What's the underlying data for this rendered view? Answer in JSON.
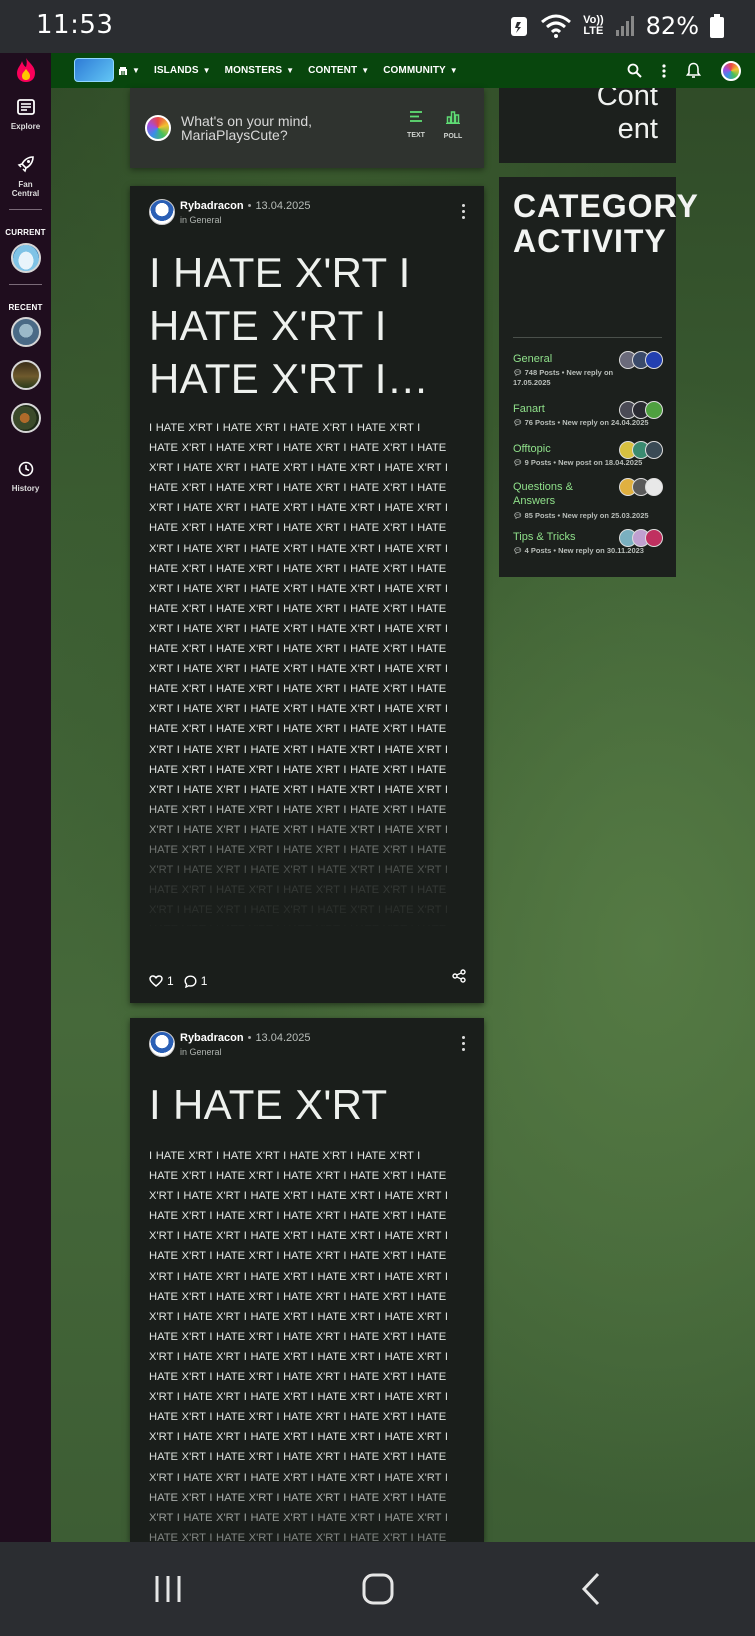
{
  "status_bar": {
    "time": "11:53",
    "battery_pct": "82%",
    "network": "LTE"
  },
  "left_rail": {
    "explore_label": "Explore",
    "fan_central_label": "Fan Central",
    "current_label": "CURRENT",
    "recent_label": "RECENT",
    "history_label": "History"
  },
  "top_nav": {
    "links": [
      "ISLANDS",
      "MONSTERS",
      "CONTENT",
      "COMMUNITY"
    ]
  },
  "composer": {
    "prompt_line1": "What's on your mind,",
    "prompt_line2": "MariaPlaysCute?",
    "text_label": "TEXT",
    "poll_label": "POLL"
  },
  "posts": [
    {
      "author": "Rybadracon",
      "date": "13.04.2025",
      "category": "in General",
      "title_line1": "I HATE X'RT I",
      "title_line2": "HATE X'RT I",
      "title_line3": "HATE X'RT I…",
      "body": "I HATE X'RT I HATE X'RT I HATE X'RT I HATE X'RT I HATE X'RT I HATE X'RT I HATE X'RT I HATE X'RT I HATE X'RT I HATE X'RT I HATE X'RT I HATE X'RT I HATE X'RT I HATE X'RT I HATE X'RT I HATE X'RT I HATE X'RT I HATE X'RT I HATE X'RT I HATE X'RT I HATE X'RT I HATE X'RT I HATE X'RT I HATE X'RT I HATE X'RT I HATE X'RT I HATE X'RT I HATE X'RT I HATE X'RT I HATE X'RT I HATE X'RT I HATE X'RT I HATE X'RT I HATE X'RT I HATE X'RT I HATE X'RT I HATE X'RT I HATE X'RT I HATE X'RT I HATE X'RT I HATE X'RT I HATE X'RT I HATE X'RT I HATE X'RT I HATE X'RT I HATE X'RT I HATE X'RT I HATE X'RT I HATE X'RT I HATE X'RT I HATE X'RT I HATE X'RT I HATE X'RT I HATE X'RT I HATE X'RT I HATE X'RT I HATE X'RT I HATE X'RT I HATE X'RT I HATE X'RT I HATE X'RT I HATE X'RT I HATE X'RT I HATE X'RT I HATE X'RT I HATE X'RT I HATE X'RT I HATE X'RT I HATE X'RT I HATE X'RT I HATE X'RT I HATE X'RT I HATE X'RT I HATE X'RT I HATE X'RT I HATE X'RT I HATE X'RT I HATE X'RT I HATE X'RT I HATE X'RT I HATE X'RT I HATE X'RT I HATE X'RT I HATE X'RT I HATE X'RT I HATE X'RT I HATE X'RT I HATE X'RT I HATE X'RT I HATE X'RT I HATE X'RT I HATE X'RT I HATE X'RT I HATE X'RT I HATE X'RT I HATE X'RT I HATE X'RT I HATE X'RT I HATE X'RT I HATE X'RT I HATE X'RT I HATE X'RT I HATE X'RT I HATE X'RT I HATE X'RT I HATE X'RT I HATE X'RT I HATE X'RT I HATE X'RT I HATE X'RT I HATE X'RT I HATE X'RT I HATE X'RT I HATE X'RT I HATE X'RT I HATE X'RT I HATE X'RT I",
      "likes": "1",
      "comments": "1"
    },
    {
      "author": "Rybadracon",
      "date": "13.04.2025",
      "category": "in General",
      "title_line1": "I HATE X'RT",
      "body": "I HATE X'RT I HATE X'RT I HATE X'RT I HATE X'RT I HATE X'RT I HATE X'RT I HATE X'RT I HATE X'RT I HATE X'RT I HATE X'RT I HATE X'RT I HATE X'RT I HATE X'RT I HATE X'RT I HATE X'RT I HATE X'RT I HATE X'RT I HATE X'RT I HATE X'RT I HATE X'RT I HATE X'RT I HATE X'RT I HATE X'RT I HATE X'RT I HATE X'RT I HATE X'RT I HATE X'RT I HATE X'RT I HATE X'RT I HATE X'RT I HATE X'RT I HATE X'RT I HATE X'RT I HATE X'RT I HATE X'RT I HATE X'RT I HATE X'RT I HATE X'RT I HATE X'RT I HATE X'RT I HATE X'RT I HATE X'RT I HATE X'RT I HATE X'RT I HATE X'RT I HATE X'RT I HATE X'RT I HATE X'RT I HATE X'RT I HATE X'RT I HATE X'RT I HATE X'RT I HATE X'RT I HATE X'RT I HATE X'RT I HATE X'RT I HATE X'RT I HATE X'RT I HATE X'RT I HATE X'RT I HATE X'RT I HATE X'RT I HATE X'RT I HATE X'RT I HATE X'RT I HATE X'RT I HATE X'RT I HATE X'RT I HATE X'RT I HATE X'RT I HATE X'RT I HATE X'RT I HATE X'RT I HATE X'RT I HATE X'RT I HATE X'RT I HATE X'RT I HATE X'RT I HATE X'RT I HATE X'RT I HATE X'RT I HATE X'RT I HATE X'RT I HATE X'RT I HATE X'RT I HATE X'RT I HATE X'RT I HATE X'RT I HATE X'RT I HATE X'RT I"
    }
  ],
  "side": {
    "top_text_line1": "Cont",
    "top_text_line2": "ent",
    "activity_title": "CATEGORY ACTIVITY",
    "categories": [
      {
        "name": "General",
        "meta": "748 Posts • New reply on 17.05.2025"
      },
      {
        "name": "Fanart",
        "meta": "76 Posts • New reply on 24.04.2025"
      },
      {
        "name": "Offtopic",
        "meta": "9 Posts • New post on 18.04.2025"
      },
      {
        "name": "Questions & Answers",
        "meta": "85 Posts • New reply on 25.03.2025"
      },
      {
        "name": "Tips & Tricks",
        "meta": "4 Posts • New reply on 30.11.2023"
      }
    ]
  },
  "colors": {
    "nav_green": "#08460d",
    "rail_purple": "#1f0d1e",
    "card_dark": "#1a1e1b",
    "category_link": "#8fe08a"
  },
  "icons": [
    "fandom-flame-icon",
    "explore-icon",
    "fan-central-rocket-icon",
    "history-clock-icon",
    "search-icon",
    "kebab-menu-icon",
    "bell-icon",
    "heart-icon",
    "comment-icon",
    "share-icon",
    "text-post-icon",
    "poll-icon"
  ]
}
